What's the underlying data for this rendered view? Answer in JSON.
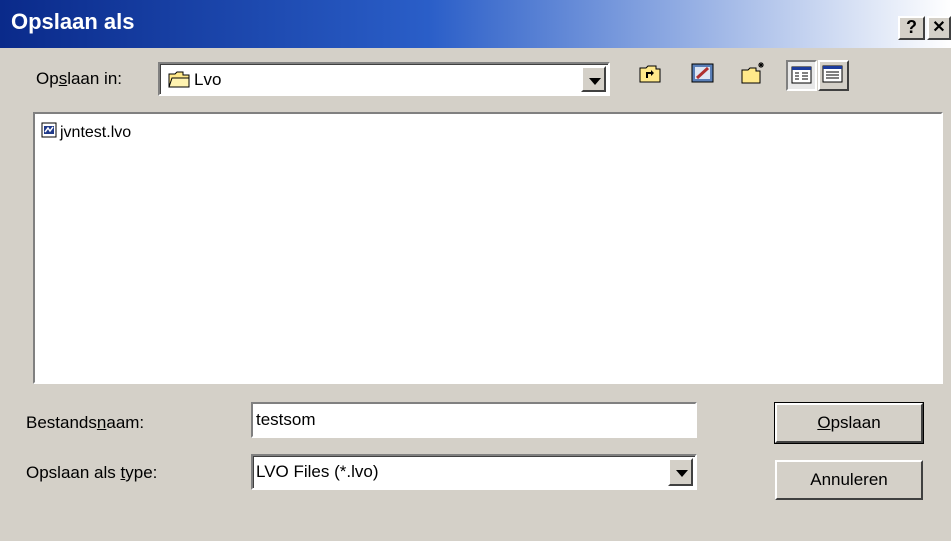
{
  "window": {
    "title": "Opslaan als",
    "help_label": "?",
    "close_label": "✕"
  },
  "save_in": {
    "label_pre": "Op",
    "label_underlined": "s",
    "label_post": "laan in:",
    "value": "Lvo"
  },
  "toolbar": {
    "icons": [
      "up-folder-icon",
      "desktop-icon",
      "new-folder-icon",
      "list-view-icon",
      "details-view-icon"
    ]
  },
  "files": [
    {
      "name": "jvntest.lvo",
      "icon": "file-icon"
    }
  ],
  "filename": {
    "label_pre": "Bestands",
    "label_underlined": "n",
    "label_post": "aam:",
    "value": "testsom"
  },
  "filetype": {
    "label_pre": "Opslaan als ",
    "label_underlined": "t",
    "label_post": "ype:",
    "value": "LVO Files (*.lvo)"
  },
  "buttons": {
    "save_underlined": "O",
    "save_rest": "pslaan",
    "cancel": "Annuleren"
  }
}
